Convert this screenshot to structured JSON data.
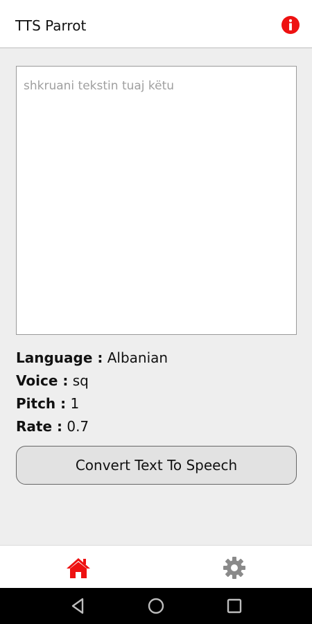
{
  "app": {
    "title": "TTS Parrot",
    "accent_color": "#ee1111",
    "info_icon": "info-icon"
  },
  "input": {
    "placeholder": "shkruani tekstin tuaj këtu",
    "value": ""
  },
  "settings_summary": {
    "language_label": "Language :",
    "language_value": "Albanian",
    "voice_label": "Voice :",
    "voice_value": "sq",
    "pitch_label": "Pitch :",
    "pitch_value": "1",
    "rate_label": "Rate :",
    "rate_value": "0.7"
  },
  "actions": {
    "convert_label": "Convert Text To Speech"
  },
  "bottom_nav": {
    "items": [
      {
        "icon": "home-icon",
        "active": true,
        "color": "#ee1111"
      },
      {
        "icon": "gear-icon",
        "active": false,
        "color": "#8a8a8a"
      }
    ]
  },
  "system_nav": {
    "items": [
      "back-icon",
      "home-circle-icon",
      "recent-apps-icon"
    ]
  }
}
